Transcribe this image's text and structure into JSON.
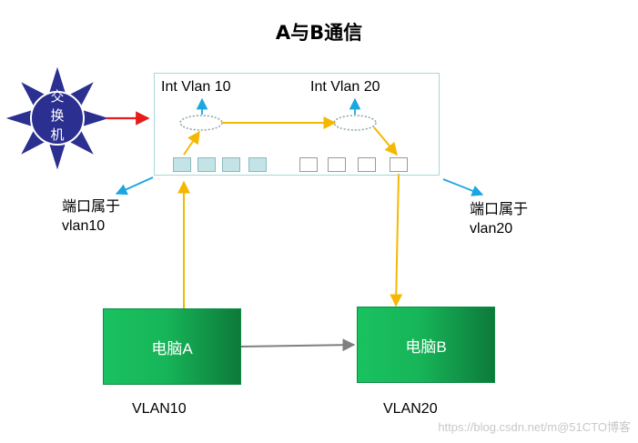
{
  "title": "A与B通信",
  "switch_label": "交换机",
  "switch_label_chars": [
    "交",
    "换",
    "机"
  ],
  "interfaces": {
    "left": "Int  Vlan 10",
    "right": "Int  Vlan 20"
  },
  "ports": {
    "vlan10_count": 4,
    "vlan20_count": 4
  },
  "port_notes": {
    "left": {
      "line1": "端口属于",
      "line2": "vlan10"
    },
    "right": {
      "line1": "端口属于",
      "line2": "vlan20"
    }
  },
  "computers": {
    "a": {
      "label": "电脑A",
      "vlan": "VLAN10"
    },
    "b": {
      "label": "电脑B",
      "vlan": "VLAN20"
    }
  },
  "watermark": "https://blog.csdn.net/m@51CTO博客",
  "colors": {
    "star_fill": "#2b2f8f",
    "flow_arrow": "#f5b800",
    "pointer_arrow": "#1aa6df",
    "switch_arrow": "#e51c1c",
    "direct_arrow": "#7f7f7f",
    "pc_green": "#17b559"
  }
}
